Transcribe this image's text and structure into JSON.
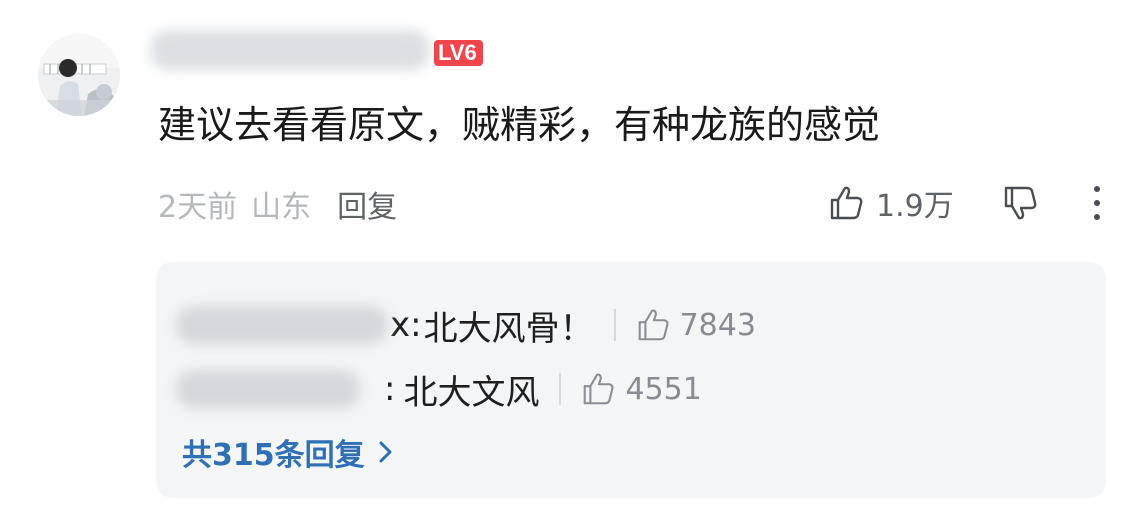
{
  "comment": {
    "avatar_icon": "avatar-photo-icon",
    "username": "",
    "level": "LV6",
    "text": "建议去看看原文，贼精彩，有种龙族的感觉",
    "time": "2天前",
    "location": "山东",
    "reply_label": "回复",
    "like_count": "1.9万",
    "icons": [
      "thumbs-up-icon",
      "thumbs-down-icon",
      "more-vertical-icon"
    ]
  },
  "replies": {
    "items": [
      {
        "author_tail": "x",
        "separator": ":",
        "text": "北大风骨！",
        "like_count": "7843"
      },
      {
        "author_tail": "",
        "separator": ":",
        "text": "北大文风",
        "like_count": "4551"
      }
    ],
    "more_label": "共315条回复",
    "more_icon": "chevron-right-icon"
  },
  "colors": {
    "badge": "#f0454d",
    "link": "#2f6fb6",
    "reply_bg": "#f4f5f7"
  }
}
